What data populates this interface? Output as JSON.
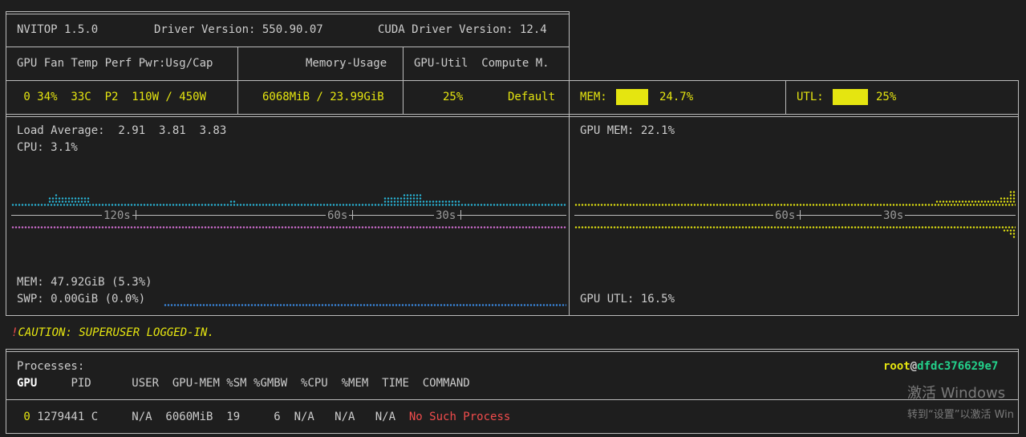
{
  "header": {
    "app": "NVITOP 1.5.0",
    "driver": "Driver Version: 550.90.07",
    "cuda": "CUDA Driver Version: 12.4"
  },
  "columns": {
    "left": "GPU Fan Temp Perf Pwr:Usg/Cap",
    "memory": "Memory-Usage",
    "util": "GPU-Util  Compute M."
  },
  "gpu": {
    "row_left": " 0 34%  33C  P2  110W / 450W",
    "memory": "6068MiB / 23.99GiB",
    "util": "25%",
    "compute": "Default",
    "mem_label": "MEM:",
    "mem_pct": "24.7%",
    "mem_fraction": 0.247,
    "utl_label": "UTL:",
    "utl_pct": "25%",
    "utl_fraction": 0.25
  },
  "host": {
    "load": "Load Average:  2.91  3.81  3.83",
    "cpu": "CPU: 3.1%",
    "mem": "MEM: 47.92GiB (5.3%)",
    "swp": "SWP: 0.00GiB (0.0%)",
    "gpu_mem": "GPU MEM: 22.1%",
    "gpu_utl": "GPU UTL: 16.5%"
  },
  "timeline": {
    "left_ticks": [
      "120s",
      "60s",
      "30s"
    ],
    "right_ticks": [
      "60s",
      "30s"
    ]
  },
  "caution": {
    "mark": "!",
    "text": "CAUTION: SUPERUSER LOGGED-IN."
  },
  "processes": {
    "title": "Processes:",
    "user": "root",
    "at": "@",
    "host": "dfdc376629e7",
    "headers": {
      "gpu": "GPU",
      "rest": "     PID      USER  GPU-MEM %SM %GMBW  %CPU  %MEM  TIME  COMMAND"
    },
    "rows": [
      {
        "gpu": " 0",
        "rest": " 1279441 C     N/A  6060MiB  19     6  N/A   N/A   N/A  ",
        "command": "No Such Process"
      }
    ]
  },
  "watermark": {
    "line1": "激活 Windows",
    "line2": "转到“设置”以激活 Win"
  },
  "colors": {
    "background": "#1e1e1e",
    "yellow": "#e5e510",
    "cyan": "#29b8db",
    "magenta": "#d670d6",
    "blue": "#3b8eea",
    "red": "#f14c4c",
    "green": "#23d18b"
  }
}
